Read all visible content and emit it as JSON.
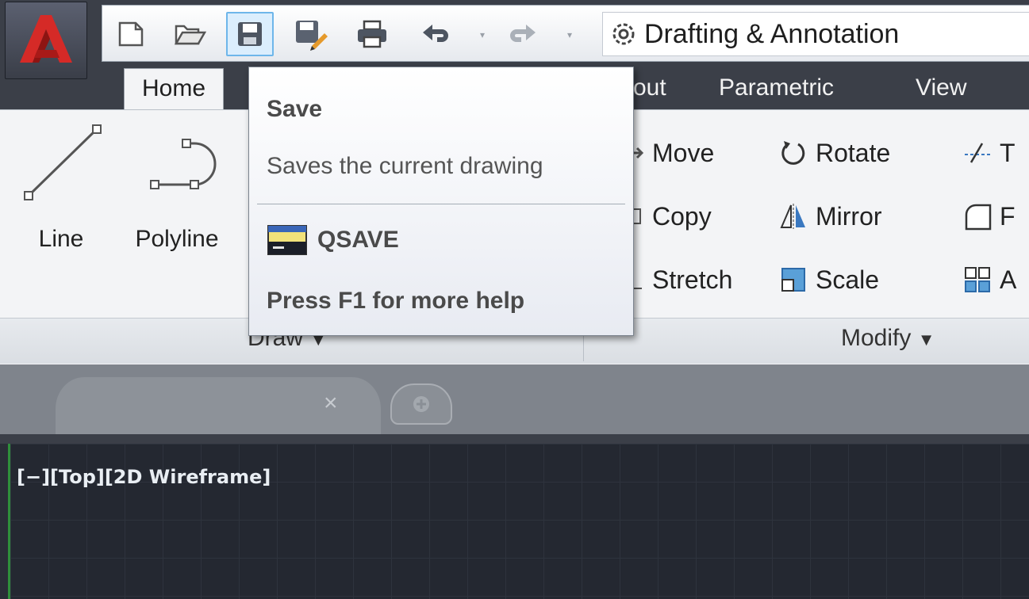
{
  "quick_access": {
    "buttons": [
      "new",
      "open",
      "save",
      "save-as",
      "plot",
      "undo",
      "redo"
    ],
    "workspace": "Drafting & Annotation"
  },
  "ribbon_tabs": [
    {
      "label": "Home",
      "active": true
    },
    {
      "label": "Layout",
      "partial_visible": "out"
    },
    {
      "label": "Parametric"
    },
    {
      "label": "View"
    }
  ],
  "draw_panel": {
    "title": "Draw",
    "tools": [
      {
        "label": "Line",
        "icon": "line-icon"
      },
      {
        "label": "Polyline",
        "icon": "polyline-icon"
      }
    ]
  },
  "modify_panel": {
    "title": "Modify",
    "tools": [
      {
        "label": "Move",
        "icon": "move-icon"
      },
      {
        "label": "Rotate",
        "icon": "rotate-icon"
      },
      {
        "label": "Copy",
        "icon": "copy-icon"
      },
      {
        "label": "Mirror",
        "icon": "mirror-icon"
      },
      {
        "label": "Stretch",
        "icon": "stretch-icon"
      },
      {
        "label": "Scale",
        "icon": "scale-icon"
      },
      {
        "label": "T",
        "icon": "trim-icon"
      },
      {
        "label": "F",
        "icon": "fillet-icon"
      },
      {
        "label": "A",
        "icon": "array-icon"
      }
    ]
  },
  "tooltip": {
    "title": "Save",
    "description": "Saves the current drawing",
    "command": "QSAVE",
    "help": "Press F1 for more help"
  },
  "file_tabs": {
    "close_glyph": "×"
  },
  "viewport": {
    "label": "[−][Top][2D Wireframe]"
  },
  "colors": {
    "app_red": "#c8201f",
    "canvas_bg": "#242831",
    "ribbon_bg": "#f3f4f6",
    "titlebar_bg": "#3b3f48"
  }
}
